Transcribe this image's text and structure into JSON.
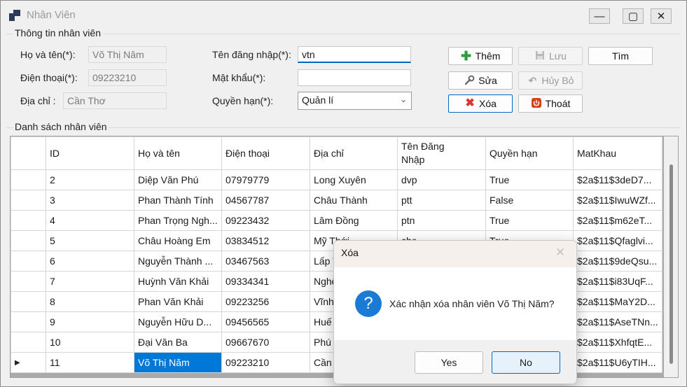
{
  "window": {
    "title": "Nhân Viên",
    "controls": {
      "minimize": "—",
      "maximize": "▢",
      "close": "✕"
    }
  },
  "form": {
    "group_title": "Thông tin nhân viên",
    "fullname_label": "Họ và tên(*):",
    "fullname_value": "Võ Thị Năm",
    "phone_label": "Điện thoại(*):",
    "phone_value": "09223210",
    "address_label": "Địa chỉ :",
    "address_value": "Cần Thơ",
    "username_label": "Tên đăng nhập(*):",
    "username_value": "vtn",
    "password_label": "Mật khẩu(*):",
    "password_value": "",
    "role_label": "Quyền hạn(*):",
    "role_value": "Quản lí"
  },
  "buttons": {
    "add": "Thêm",
    "save": "Lưu",
    "search": "Tìm",
    "edit": "Sửa",
    "cancel": "Hủy Bỏ",
    "delete": "Xóa",
    "exit": "Thoát"
  },
  "list": {
    "group_title": "Danh sách nhân viên",
    "columns": [
      "ID",
      "Họ và tên",
      "Điện thoại",
      "Địa chỉ",
      "Tên Đăng Nhập",
      "Quyền hạn",
      "MatKhau"
    ],
    "rows": [
      [
        "2",
        "Diệp Văn Phú",
        "07979779",
        "Long Xuyên",
        "dvp",
        "True",
        "$2a$11$3deD7..."
      ],
      [
        "3",
        "Phan Thành Tính",
        "04567787",
        "Châu Thành",
        "ptt",
        "False",
        "$2a$11$IwuWZf..."
      ],
      [
        "4",
        "Phan Trọng Ngh...",
        "09223432",
        "Lâm Đồng",
        "ptn",
        "True",
        "$2a$11$m62eT..."
      ],
      [
        "5",
        "Châu Hoàng Em",
        "03834512",
        "Mỹ Thới",
        "che",
        "True",
        "$2a$11$Qfaglvi..."
      ],
      [
        "6",
        "Nguyễn Thành ...",
        "03467563",
        "Lấp Vò",
        "",
        "",
        "$2a$11$9deQsu..."
      ],
      [
        "7",
        "Huỳnh Văn Khải",
        "09334341",
        "Nghệ An",
        "",
        "",
        "$2a$11$i83UqF..."
      ],
      [
        "8",
        "Phan Văn Khải",
        "09223256",
        "Vĩnh Long",
        "",
        "",
        "$2a$11$MaY2D..."
      ],
      [
        "9",
        "Nguyễn Hữu D...",
        "09456565",
        "Huế",
        "",
        "",
        "$2a$11$AseTNn..."
      ],
      [
        "10",
        "Đại Văn Ba",
        "09667670",
        "Phú Quốc",
        "",
        "",
        "$2a$11$XhfqtE..."
      ],
      [
        "11",
        "Võ Thị Năm",
        "09223210",
        "Cần Thơ",
        "",
        "",
        "$2a$11$U6yTIH..."
      ]
    ],
    "current_row_marker": "▶"
  },
  "dialog": {
    "title": "Xóa",
    "close": "✕",
    "icon": "?",
    "message": "Xác nhận xóa nhân viên Võ Thị Năm?",
    "yes": "Yes",
    "no": "No"
  },
  "colors": {
    "selection": "#0078d7",
    "focus_border": "#0067c0",
    "add_icon": "#2e9e3b",
    "delete_icon": "#d8392c",
    "exit_icon": "#d84315",
    "question_icon": "#1a7ad4"
  }
}
